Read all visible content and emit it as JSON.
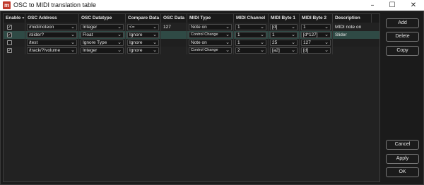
{
  "window": {
    "title": "OSC to MIDI translation table",
    "app_icon": "midi-app-icon",
    "minimize_glyph": "–",
    "maximize_glyph": "☐",
    "close_glyph": "✕"
  },
  "table": {
    "columns": [
      {
        "label": "Enable",
        "sort_glyph": "▼"
      },
      {
        "label": "OSC Address"
      },
      {
        "label": "OSC Datatype"
      },
      {
        "label": "Compare Data"
      },
      {
        "label": "OSC Data"
      },
      {
        "label": "MIDI Type"
      },
      {
        "label": "MIDI Channel"
      },
      {
        "label": "MIDI Byte 1"
      },
      {
        "label": "MIDI Byte 2"
      },
      {
        "label": "Description"
      }
    ],
    "rows": [
      {
        "enabled": true,
        "osc_address": "/midi/noteon",
        "osc_datatype": "Integer",
        "compare": "<=",
        "osc_data": "127",
        "midi_type": "Note on",
        "channel": "1",
        "byte1": "[d]",
        "byte2": "1",
        "description": "MIDI note on"
      },
      {
        "enabled": true,
        "osc_address": "/slider?",
        "osc_datatype": "Float",
        "compare": "Ignore",
        "osc_data": "",
        "midi_type": "Control Change",
        "channel": "1",
        "byte1": "1",
        "byte2": "[d*127]",
        "description": "Slider"
      },
      {
        "enabled": false,
        "osc_address": "/test",
        "osc_datatype": "Ignore Type",
        "compare": "Ignore",
        "osc_data": "",
        "midi_type": "Note on",
        "channel": "1",
        "byte1": "25",
        "byte2": "127",
        "description": ""
      },
      {
        "enabled": true,
        "osc_address": "/track/?/volume",
        "osc_datatype": "Integer",
        "compare": "Ignore",
        "osc_data": "",
        "midi_type": "Control Change",
        "channel": "2",
        "byte1": "[a2]",
        "byte2": "[d]",
        "description": ""
      }
    ]
  },
  "buttons": {
    "add": "Add",
    "delete": "Delete",
    "copy": "Copy",
    "cancel": "Cancel",
    "apply": "Apply",
    "ok": "OK"
  },
  "glyphs": {
    "check": "✓",
    "dropdown": "⌄"
  },
  "colors": {
    "selected_row": "#2f4a45",
    "background": "#1e1e1e"
  }
}
